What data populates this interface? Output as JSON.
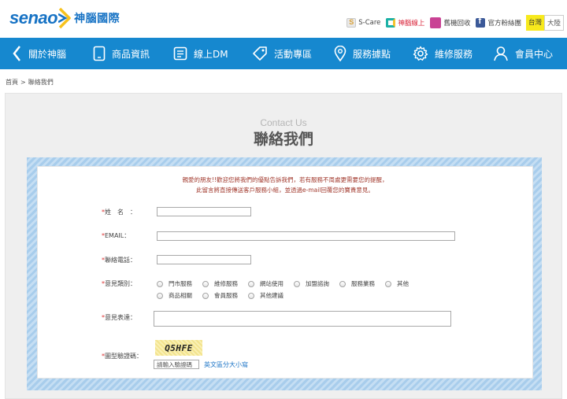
{
  "brand": {
    "logo_word": "senao",
    "logo_cn": "神腦國際"
  },
  "toplinks": [
    {
      "label": "S-Care",
      "icon": "s-care-icon"
    },
    {
      "label": "神腦線上",
      "icon": "senao-online-icon",
      "color": "#d9243a"
    },
    {
      "label": "舊機回收",
      "icon": "recycle-icon"
    },
    {
      "label": "官方粉絲團",
      "icon": "facebook-icon"
    }
  ],
  "region": {
    "active": "台灣",
    "inactive": "大陸"
  },
  "nav": [
    {
      "label": "關於神腦",
      "icon": "senao-arrow-icon"
    },
    {
      "label": "商品資訊",
      "icon": "tablet-icon"
    },
    {
      "label": "線上DM",
      "icon": "document-icon"
    },
    {
      "label": "活動專區",
      "icon": "tag-icon"
    },
    {
      "label": "服務據點",
      "icon": "location-pin-icon"
    },
    {
      "label": "維修服務",
      "icon": "gear-icon"
    },
    {
      "label": "會員中心",
      "icon": "user-icon"
    }
  ],
  "breadcrumb": {
    "home": "首頁",
    "separator": ">",
    "current": "聯絡我們"
  },
  "page": {
    "title_en": "Contact Us",
    "title_cn": "聯絡我們"
  },
  "notice": {
    "line1": "親愛的朋友!!歡迎您將我們的優點告訴我們，若有服務不周處更需要您的提醒，",
    "line2": "此留言將直接傳送客戶服務小組，並透過e-mail回覆您的寶貴意見。"
  },
  "form": {
    "required_mark": "*",
    "name_label": "姓　名　：",
    "name_value": "",
    "email_label": "EMAIL：",
    "email_value": "",
    "phone_label": "聯絡電話：",
    "phone_value": "",
    "category_label": "意見類別：",
    "categories": [
      "門市服務",
      "維修服務",
      "網站使用",
      "加盟諮詢",
      "服務業務",
      "其他",
      "商品相關",
      "會員服務",
      "其他建議"
    ],
    "comment_label": "意見表達：",
    "comment_value": "",
    "captcha_label": "圖型驗證碼：",
    "captcha_text": "Q5HFE",
    "captcha_placeholder": "請輸入驗證碼",
    "captcha_value": "",
    "case_note": "英文區分大小寫"
  },
  "colors": {
    "nav_bg": "#1688cf",
    "brand_blue": "#1672c4",
    "notice_red": "#a23a2e",
    "region_active": "#f7e91d"
  }
}
